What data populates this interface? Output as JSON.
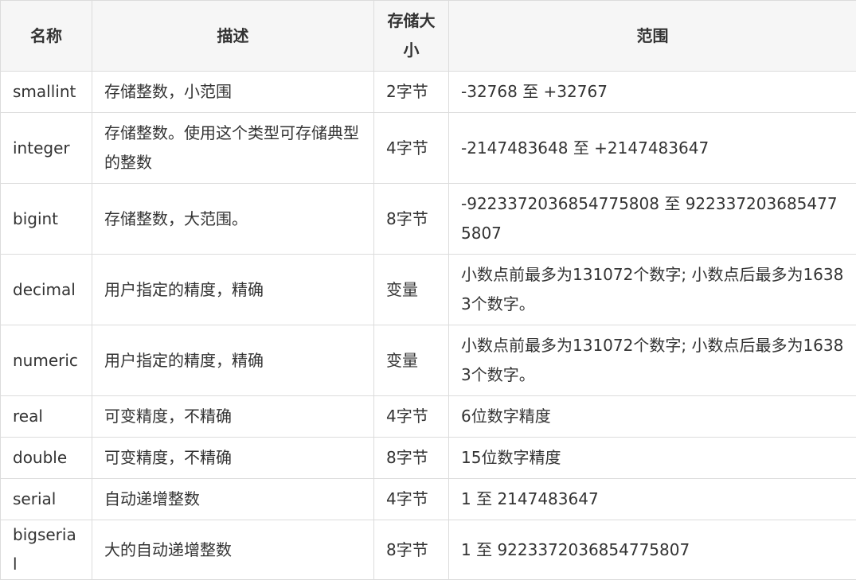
{
  "table": {
    "headers": [
      "名称",
      "描述",
      "存储大小",
      "范围"
    ],
    "rows": [
      {
        "name": "smallint",
        "desc": "存储整数，小范围",
        "size": "2字节",
        "range": "-32768 至 +32767"
      },
      {
        "name": "integer",
        "desc": "存储整数。使用这个类型可存储典型的整数",
        "size": "4字节",
        "range": "-2147483648 至 +2147483647"
      },
      {
        "name": "bigint",
        "desc": "存储整数，大范围。",
        "size": "8字节",
        "range": "-9223372036854775808 至 9223372036854775807"
      },
      {
        "name": "decimal",
        "desc": "用户指定的精度，精确",
        "size": "变量",
        "range": "小数点前最多为131072个数字; 小数点后最多为16383个数字。"
      },
      {
        "name": "numeric",
        "desc": "用户指定的精度，精确",
        "size": "变量",
        "range": "小数点前最多为131072个数字; 小数点后最多为16383个数字。"
      },
      {
        "name": "real",
        "desc": "可变精度，不精确",
        "size": "4字节",
        "range": "6位数字精度"
      },
      {
        "name": "double",
        "desc": "可变精度，不精确",
        "size": "8字节",
        "range": "15位数字精度"
      },
      {
        "name": "serial",
        "desc": "自动递增整数",
        "size": "4字节",
        "range": "1 至 2147483647"
      },
      {
        "name": "bigserial",
        "desc": "大的自动递增整数",
        "size": "8字节",
        "range": "1 至 9223372036854775807"
      }
    ]
  }
}
